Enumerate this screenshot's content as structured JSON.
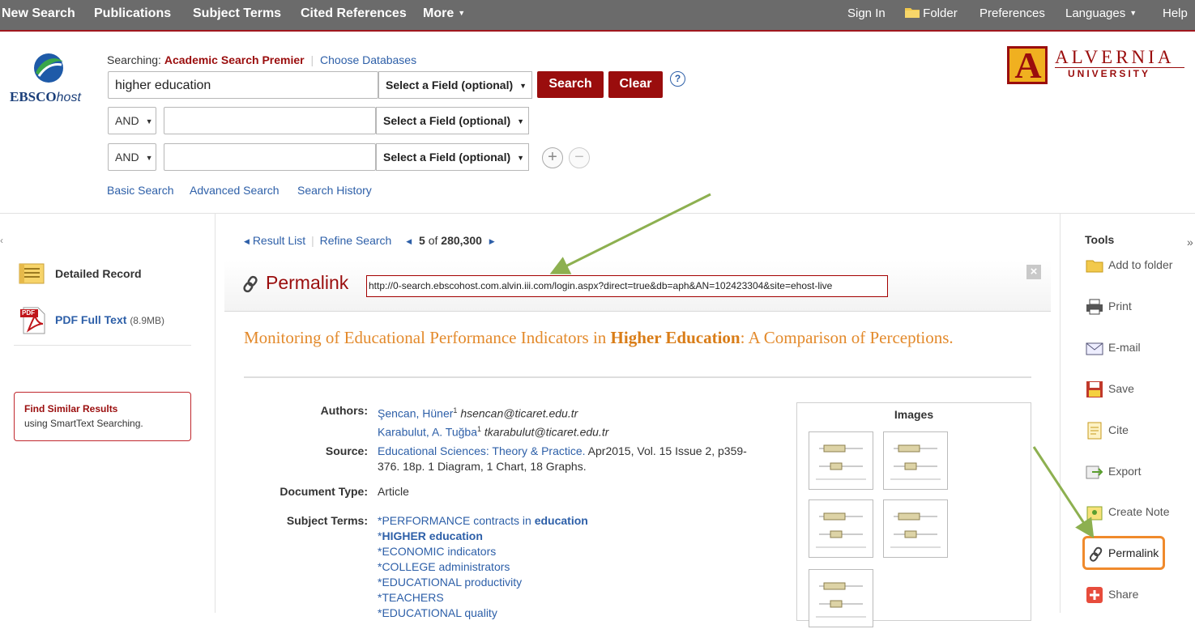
{
  "topnav": {
    "left": [
      "New Search",
      "Publications",
      "Subject Terms",
      "Cited References",
      "More"
    ],
    "right": {
      "sign_in": "Sign In",
      "folder": "Folder",
      "preferences": "Preferences",
      "languages": "Languages",
      "help": "Help"
    }
  },
  "logo": {
    "ebsco_bold": "EBSCO",
    "ebsco_italic": "host",
    "alvernia_top": "ALVERNIA",
    "alvernia_bottom": "UNIVERSITY",
    "alvernia_mark": "A"
  },
  "search": {
    "searching_label": "Searching:",
    "database": "Academic Search Premier",
    "choose_db": "Choose Databases",
    "query1": "higher education",
    "field_select": "Select a Field (optional)",
    "bool": "AND",
    "search_btn": "Search",
    "clear_btn": "Clear",
    "help": "?",
    "basic": "Basic Search",
    "advanced": "Advanced Search",
    "history": "Search History"
  },
  "sidebar": {
    "detailed": "Detailed Record",
    "pdf": "PDF Full Text",
    "pdf_size": "(8.9MB)",
    "pdf_badge": "PDF",
    "similar_title": "Find Similar Results",
    "similar_sub": "using SmartText Searching."
  },
  "resultnav": {
    "result_list": "Result List",
    "refine": "Refine Search",
    "position": "5",
    "of": "of",
    "total": "280,300"
  },
  "permalink": {
    "title": "Permalink",
    "url": "http://0-search.ebscohost.com.alvin.iii.com/login.aspx?direct=true&db=aph&AN=102423304&site=ehost-live",
    "close": "×"
  },
  "article": {
    "title_before": "Monitoring of Educational Performance Indicators in ",
    "title_bold": "Higher Education",
    "title_after": ": A Comparison of Perceptions.",
    "authors_label": "Authors:",
    "author1": "Şencan, Hüner",
    "author1_sup": "1",
    "author1_email": "hsencan@ticaret.edu.tr",
    "author2": "Karabulut, A. Tuğba",
    "author2_sup": "1",
    "author2_email": "tkarabulut@ticaret.edu.tr",
    "source_label": "Source:",
    "source_link": "Educational Sciences: Theory & Practice.",
    "source_rest1": " Apr2015, Vol. 15 Issue 2, p359-",
    "source_rest2": "376. 18p. 1 Diagram, 1 Chart, 18 Graphs.",
    "doctype_label": "Document Type:",
    "doctype": "Article",
    "subject_label": "Subject Terms:",
    "subjects": [
      {
        "pre": "*PERFORMANCE contracts in ",
        "bold": "education",
        "post": ""
      },
      {
        "pre": "*",
        "bold": "HIGHER education",
        "post": ""
      },
      {
        "pre": "*ECONOMIC indicators",
        "bold": "",
        "post": ""
      },
      {
        "pre": "*COLLEGE administrators",
        "bold": "",
        "post": ""
      },
      {
        "pre": "*EDUCATIONAL productivity",
        "bold": "",
        "post": ""
      },
      {
        "pre": "*TEACHERS",
        "bold": "",
        "post": ""
      },
      {
        "pre": "*EDUCATIONAL quality",
        "bold": "",
        "post": ""
      }
    ]
  },
  "images_panel": {
    "title": "Images"
  },
  "tools": {
    "title": "Tools",
    "items": [
      "Add to folder",
      "Print",
      "E-mail",
      "Save",
      "Cite",
      "Export",
      "Create Note",
      "Permalink",
      "Share"
    ]
  },
  "colors": {
    "brand_red": "#9a0d0d",
    "title_orange": "#e38a2c",
    "link_blue": "#2d5fa8",
    "arrow_green": "#8db050",
    "highlight_orange": "#f08a2c"
  }
}
